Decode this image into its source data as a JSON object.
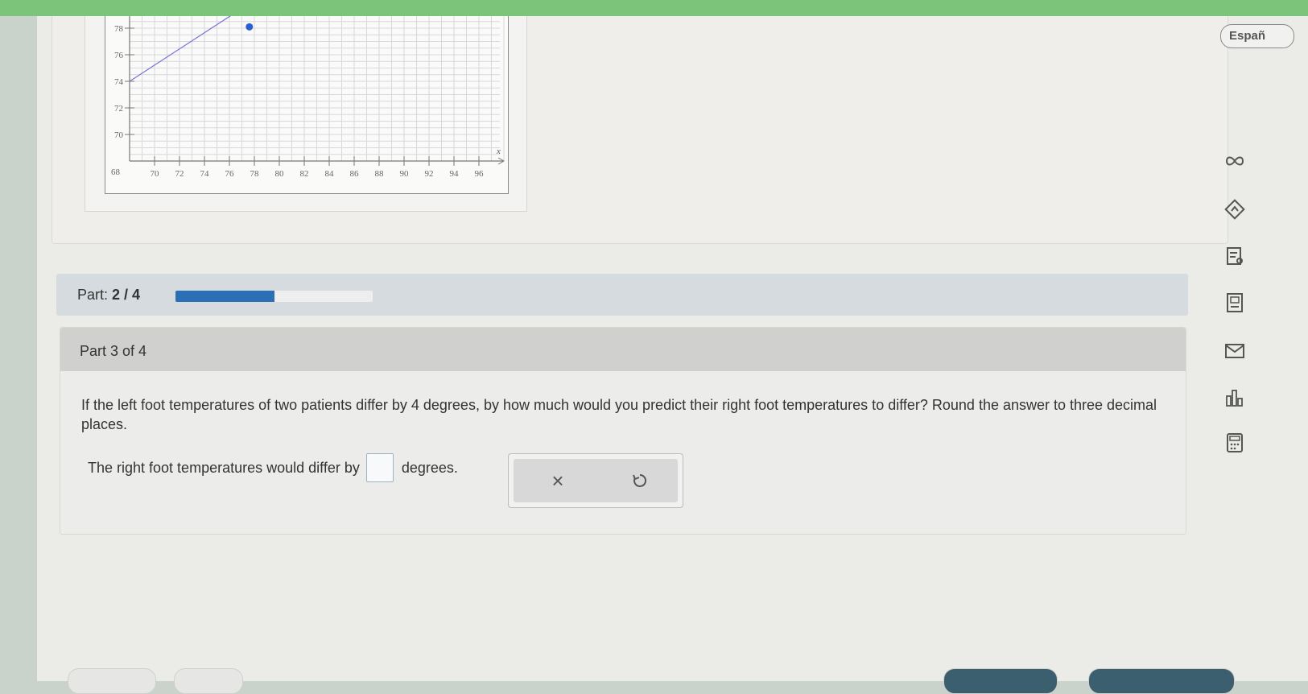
{
  "language_button": "Españ",
  "graph": {
    "y_ticks": [
      "78",
      "76",
      "74",
      "72",
      "70"
    ],
    "origin_label": "68",
    "x_ticks": [
      "70",
      "72",
      "74",
      "76",
      "78",
      "80",
      "82",
      "84",
      "86",
      "88",
      "90",
      "92",
      "94",
      "96"
    ],
    "x_axis_label": "x",
    "line_color": "#7b79d6",
    "point_color": "#2a5fd4"
  },
  "progress": {
    "label": "Part:",
    "value": "2 / 4",
    "fraction": 0.5,
    "fill_color": "#2b6fb4"
  },
  "question": {
    "header": "Part 3 of 4",
    "text": "If the left foot temperatures of two patients differ by 4 degrees, by how much would you predict their right foot temperatures to differ? Round the answer to three decimal places.",
    "answer_prefix": "The right foot temperatures would differ by",
    "answer_value": "",
    "answer_suffix": "degrees."
  },
  "actions": {
    "clear_symbol": "×",
    "undo_icon": "undo-icon"
  },
  "rail_icons": [
    "infinity-icon",
    "diamond-arrow-icon",
    "notes-icon",
    "book-icon",
    "mail-icon",
    "bar-chart-icon",
    "calculator-icon"
  ]
}
